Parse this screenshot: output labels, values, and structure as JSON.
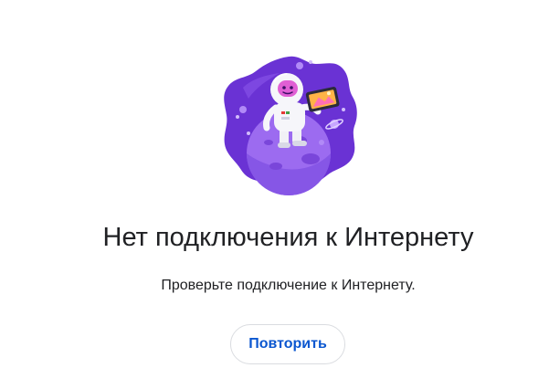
{
  "error": {
    "title": "Нет подключения к Интернету",
    "message": "Проверьте подключение к Интернету."
  },
  "actions": {
    "retry_label": "Повторить"
  },
  "colors": {
    "accent": "#0b57d0",
    "blob_purple": "#6a32d4",
    "planet_purple": "#9c6bf0",
    "text": "#202124",
    "button_border": "#dadce0"
  },
  "illustration": {
    "icon": "astronaut-on-planet-icon"
  }
}
